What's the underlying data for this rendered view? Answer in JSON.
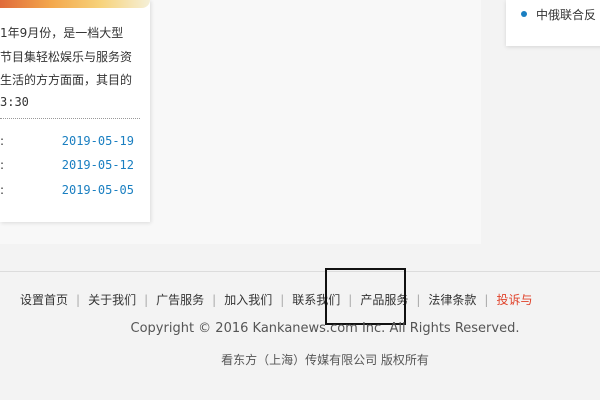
{
  "article_card": {
    "excerpt_lines": [
      "1年9月份，是一档大型",
      "节目集轻松娱乐与服务资",
      "生活的方方面面，其目的"
    ],
    "time": "3:30",
    "news_items": [
      {
        "bullet": ":",
        "date": "2019-05-19"
      },
      {
        "bullet": ":",
        "date": "2019-05-12"
      },
      {
        "bullet": ":",
        "date": "2019-05-05"
      }
    ]
  },
  "side_panel": {
    "item_text": "中俄联合反"
  },
  "footer": {
    "links": [
      "设置首页",
      "关于我们",
      "广告服务",
      "加入我们",
      "联系我们",
      "产品服务",
      "法律条款",
      "投诉与"
    ],
    "separator": "|",
    "copyright": "Copyright © 2016 Kankanews.com Inc. All Rights Reserved.",
    "company": "看东方（上海）传媒有限公司 版权所有"
  },
  "colors": {
    "link": "#333333",
    "date_blue": "#1a7fc1",
    "hot_link": "#e0432b"
  }
}
